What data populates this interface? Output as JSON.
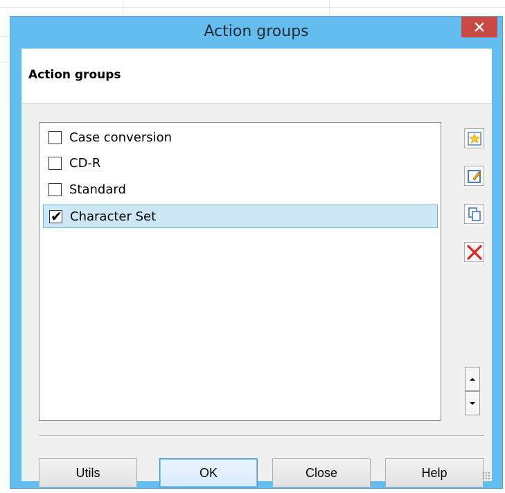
{
  "window": {
    "title": "Action groups",
    "close_icon": "close-icon"
  },
  "header": {
    "title": "Action groups"
  },
  "list": {
    "items": [
      {
        "label": "Case conversion",
        "checked": false,
        "selected": false
      },
      {
        "label": "CD-R",
        "checked": false,
        "selected": false
      },
      {
        "label": "Standard",
        "checked": false,
        "selected": false
      },
      {
        "label": "Character Set",
        "checked": true,
        "selected": true
      }
    ]
  },
  "side_toolbar": {
    "icons": [
      "new-star-icon",
      "edit-icon",
      "copy-icon",
      "delete-icon",
      "move-up-icon",
      "move-down-icon"
    ]
  },
  "buttons": {
    "utils": "Utils",
    "ok": "OK",
    "close": "Close",
    "help": "Help"
  },
  "colors": {
    "titlebar": "#63bdef",
    "close_button": "#c94a44",
    "selection_bg": "#cce8f7",
    "selection_border": "#67b3df",
    "delete_red": "#e0231a"
  }
}
